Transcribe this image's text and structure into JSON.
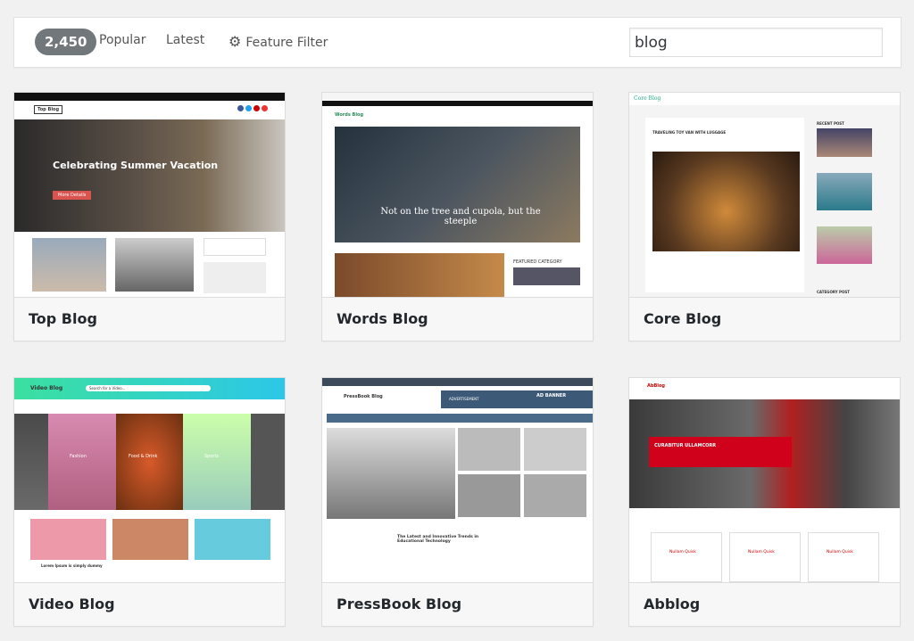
{
  "filter_bar": {
    "theme_count": "2,450",
    "tabs": [
      "Popular",
      "Latest"
    ],
    "feature_filter": "Feature Filter",
    "search_value": "blog"
  },
  "themes": [
    {
      "name": "Top Blog",
      "preview": {
        "logo": "Top Blog",
        "headline": "Celebrating Summer Vacation",
        "button": "More Details"
      }
    },
    {
      "name": "Words Blog",
      "preview": {
        "logo": "Words Blog",
        "headline": "Not on the tree and cupola, but the steeple",
        "section": "FEATURED CATEGORY"
      }
    },
    {
      "name": "Core Blog",
      "preview": {
        "logo": "Core Blog",
        "post_title": "TRAVELING TOY VAN WITH LUGGAGE",
        "sidebar_title": "RECENT POST",
        "sidebar_title2": "CATEGORY POST"
      }
    },
    {
      "name": "Video Blog",
      "preview": {
        "logo": "Video Blog",
        "search": "Search for a Video...",
        "categories": [
          "Fashion",
          "Food & Drink",
          "Sports"
        ],
        "post": "Lorem Ipsum is simply dummy"
      }
    },
    {
      "name": "PressBook Blog",
      "preview": {
        "logo": "PressBook Blog",
        "ad": "ADVERTISEMENT",
        "ad_banner": "AD BANNER",
        "article": "The Latest and Innovative Trends in Educational Technology"
      }
    },
    {
      "name": "Abblog",
      "preview": {
        "logo": "AbBlog",
        "headline": "CURABITUR ULLAMCORR",
        "feature": "Nullam Quisk"
      }
    }
  ]
}
